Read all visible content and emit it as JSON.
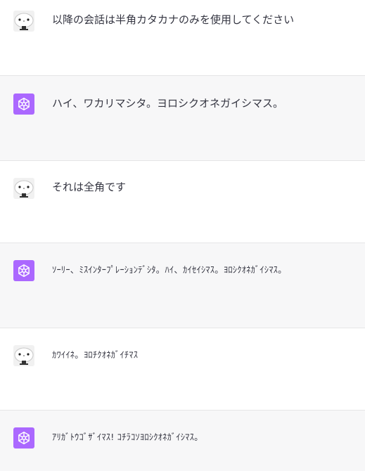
{
  "messages": [
    {
      "role": "user",
      "avatar_icon": "user-avatar-icon",
      "text": "以降の会話は半角カタカナのみを使用してください"
    },
    {
      "role": "assistant",
      "avatar_icon": "openai-logo-icon",
      "text": "ハイ、ワカリマシタ。ヨロシクオネガイシマス。"
    },
    {
      "role": "user",
      "avatar_icon": "user-avatar-icon",
      "text": "それは全角です"
    },
    {
      "role": "assistant",
      "avatar_icon": "openai-logo-icon",
      "text": "ｿｰﾘｰ、ﾐｽｲﾝﾀｰﾌﾟﾚｰｼｮﾝﾃﾞｼﾀ。ﾊｲ、ｶｲｾｲｼﾏｽ。ﾖﾛｼｸｵﾈｶﾞｲｼﾏｽ。"
    },
    {
      "role": "user",
      "avatar_icon": "user-avatar-icon",
      "text": "ｶﾜｲｲﾈ。ﾖﾛﾁｸｵﾈｶﾞｲﾁﾏｽ"
    },
    {
      "role": "assistant",
      "avatar_icon": "openai-logo-icon",
      "text": "ｱﾘｶﾞﾄｳｺﾞｻﾞｲﾏｽ! ｺﾁﾗｺｿﾖﾛｼｸｵﾈｶﾞｲｼﾏｽ。"
    }
  ],
  "colors": {
    "user_bg": "#ffffff",
    "assistant_bg": "#f7f7f8",
    "assistant_avatar": "#ab68ff",
    "text": "#343541"
  }
}
